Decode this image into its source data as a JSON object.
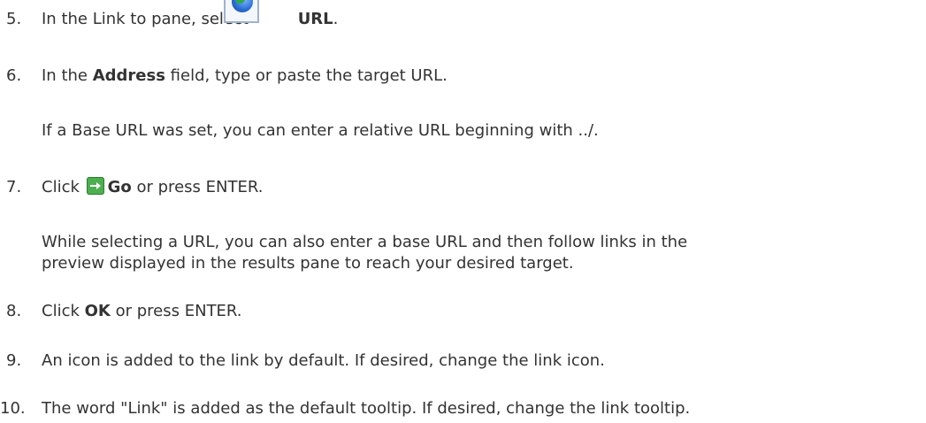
{
  "steps": [
    {
      "num": "5.",
      "parts": [
        "In the Link to pane, select",
        "URL",
        "."
      ]
    },
    {
      "num": "6.",
      "parts": [
        "In the",
        "Address",
        "field, type or paste the target URL."
      ]
    },
    {
      "note": "If a Base URL was set, you can enter a relative URL beginning with ../."
    },
    {
      "num": "7.",
      "parts": [
        "Click",
        "Go",
        "or press ENTER."
      ]
    },
    {
      "note_lines": [
        "While selecting a URL, you can also enter a base URL and then follow links in the",
        "preview displayed in the results pane to reach your desired target."
      ]
    },
    {
      "num": "8.",
      "parts": [
        "Click",
        "OK",
        "or press ENTER."
      ]
    },
    {
      "num": "9.",
      "parts": [
        "An icon is added to the link by default. If desired, change the link icon."
      ]
    },
    {
      "num": "10.",
      "parts": [
        "The word \"Link\" is added as the default tooltip. If desired, change the link tooltip."
      ]
    }
  ],
  "icons": {
    "url": "globe-icon",
    "go": "green-arrow-icon"
  }
}
